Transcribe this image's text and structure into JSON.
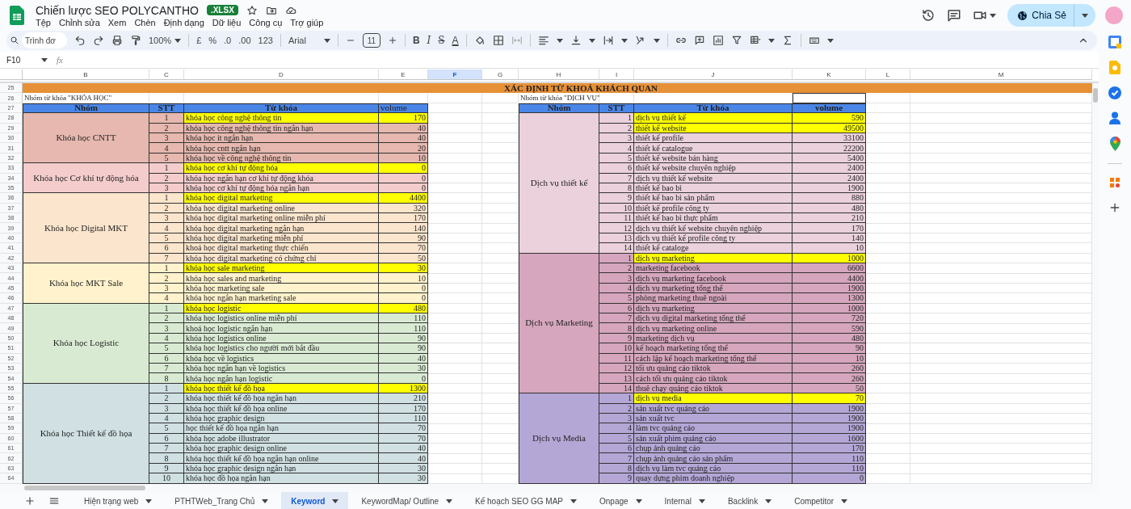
{
  "app": {
    "title": "Chiến lược SEO POLYCANTHO",
    "badge": ".XLSX",
    "menus": [
      "Tệp",
      "Chỉnh sửa",
      "Xem",
      "Chèn",
      "Định dạng",
      "Dữ liệu",
      "Công cụ",
      "Trợ giúp"
    ],
    "share_button": "Chia Sẻ"
  },
  "toolbar": {
    "search_placeholder": "Trình đơ",
    "zoom": "100%",
    "number_buttons": [
      "£",
      "%",
      ".0",
      ".00",
      "123"
    ],
    "font": "Arial",
    "font_size": "11",
    "text_buttons": [
      {
        "kind": "bold",
        "label": "B"
      },
      {
        "kind": "italic",
        "label": "I"
      },
      {
        "kind": "strike",
        "label": "S"
      },
      {
        "kind": "color",
        "label": "A"
      }
    ]
  },
  "formula_bar": {
    "cell_ref": "F10",
    "fx": "fx"
  },
  "columns": [
    {
      "label": "B",
      "selected": false
    },
    {
      "label": "C",
      "selected": false
    },
    {
      "label": "D",
      "selected": false
    },
    {
      "label": "E",
      "selected": false
    },
    {
      "label": "F",
      "selected": true
    },
    {
      "label": "G",
      "selected": false
    },
    {
      "label": "H",
      "selected": false
    },
    {
      "label": "I",
      "selected": false
    },
    {
      "label": "J",
      "selected": false
    },
    {
      "label": "K",
      "selected": false
    },
    {
      "label": "L",
      "selected": false
    },
    {
      "label": "M",
      "selected": false
    }
  ],
  "rows": [
    "25",
    "26",
    "27",
    "28",
    "29",
    "30",
    "31",
    "32",
    "33",
    "34",
    "35",
    "36",
    "37",
    "38",
    "39",
    "40",
    "41",
    "42",
    "43",
    "44",
    "45",
    "46",
    "47",
    "48",
    "49",
    "50",
    "51",
    "52",
    "53",
    "54",
    "55",
    "56",
    "57",
    "58",
    "59",
    "60",
    "61",
    "62",
    "63",
    "64"
  ],
  "title": "XÁC ĐỊNH TỪ KHOÁ KHÁCH QUAN",
  "tables": [
    {
      "caption": "Nhóm từ khóa \"KHÓA HỌC\"",
      "headers": [
        "Nhóm",
        "STT",
        "Từ khóa",
        "volume"
      ],
      "groups": [
        {
          "name": "Khóa học CNTT",
          "color": "#e6b8af",
          "rows": [
            {
              "stt": "1",
              "keyword": "khóa học công nghệ thông tin",
              "volume": "170",
              "highlighted": true
            },
            {
              "stt": "2",
              "keyword": "khóa học công nghệ thông tin ngắn hạn",
              "volume": "40",
              "highlighted": false
            },
            {
              "stt": "3",
              "keyword": "khóa học it ngắn hạn",
              "volume": "40",
              "highlighted": false
            },
            {
              "stt": "4",
              "keyword": "khóa học cntt ngắn hạn",
              "volume": "20",
              "highlighted": false
            },
            {
              "stt": "5",
              "keyword": "khóa học về công nghệ thông tin",
              "volume": "10",
              "highlighted": false
            }
          ]
        },
        {
          "name": "Khóa học Cơ khí tự động hóa",
          "color": "#f4cccc",
          "rows": [
            {
              "stt": "1",
              "keyword": "khóa học cơ khí tự động hóa",
              "volume": "0",
              "highlighted": true
            },
            {
              "stt": "2",
              "keyword": "khóa học ngắn hạn cơ khí tự động khóa",
              "volume": "0",
              "highlighted": false
            },
            {
              "stt": "3",
              "keyword": "khóa học cơ khí tự động hóa ngắn hạn",
              "volume": "0",
              "highlighted": false
            }
          ]
        },
        {
          "name": "Khóa học Digital MKT",
          "color": "#fce5cd",
          "rows": [
            {
              "stt": "1",
              "keyword": "khóa học digital marketing",
              "volume": "4400",
              "highlighted": true
            },
            {
              "stt": "2",
              "keyword": "khóa học digital marketing online",
              "volume": "320",
              "highlighted": false
            },
            {
              "stt": "3",
              "keyword": "khóa học digital marketing online miễn phí",
              "volume": "170",
              "highlighted": false
            },
            {
              "stt": "4",
              "keyword": "khóa học digital marketing ngắn hạn",
              "volume": "140",
              "highlighted": false
            },
            {
              "stt": "5",
              "keyword": "khóa học digital marketing miễn phí",
              "volume": "90",
              "highlighted": false
            },
            {
              "stt": "6",
              "keyword": "khoá học digital marketing thực chiến",
              "volume": "70",
              "highlighted": false
            },
            {
              "stt": "7",
              "keyword": "khóa học digital marketing có chứng chỉ",
              "volume": "50",
              "highlighted": false
            }
          ]
        },
        {
          "name": "Khóa học MKT Sale",
          "color": "#fff2cc",
          "rows": [
            {
              "stt": "1",
              "keyword": "khóa học sale marketing",
              "volume": "30",
              "highlighted": true
            },
            {
              "stt": "2",
              "keyword": "khóa học sales and marketing",
              "volume": "10",
              "highlighted": false
            },
            {
              "stt": "3",
              "keyword": "khóa học marketing sale",
              "volume": "0",
              "highlighted": false
            },
            {
              "stt": "4",
              "keyword": "khóa học ngắn hạn marketing sale",
              "volume": "0",
              "highlighted": false
            }
          ]
        },
        {
          "name": "Khóa học Logistic",
          "color": "#d9ead3",
          "rows": [
            {
              "stt": "1",
              "keyword": "khóa học logistic",
              "volume": "480",
              "highlighted": true
            },
            {
              "stt": "2",
              "keyword": "khóa học logistics online miễn phí",
              "volume": "110",
              "highlighted": false
            },
            {
              "stt": "3",
              "keyword": "khoá học logistic ngắn hạn",
              "volume": "110",
              "highlighted": false
            },
            {
              "stt": "4",
              "keyword": "khóa học logistics online",
              "volume": "90",
              "highlighted": false
            },
            {
              "stt": "5",
              "keyword": "khóa học logistics cho người mới bắt đầu",
              "volume": "90",
              "highlighted": false
            },
            {
              "stt": "6",
              "keyword": "khóa học về logistics",
              "volume": "40",
              "highlighted": false
            },
            {
              "stt": "7",
              "keyword": "khóa học ngắn hạn về logistics",
              "volume": "30",
              "highlighted": false
            },
            {
              "stt": "8",
              "keyword": "khóa học ngắn hạn logistic",
              "volume": "0",
              "highlighted": false
            }
          ]
        },
        {
          "name": "Khóa học Thiết kế đồ họa",
          "color": "#d0e0e3",
          "rows": [
            {
              "stt": "1",
              "keyword": "khóa học thiết kế đồ họa",
              "volume": "1300",
              "highlighted": true
            },
            {
              "stt": "2",
              "keyword": "khóa học thiết kế đồ họa ngắn hạn",
              "volume": "210",
              "highlighted": false
            },
            {
              "stt": "3",
              "keyword": "khóa học thiết kế đồ họa online",
              "volume": "170",
              "highlighted": false
            },
            {
              "stt": "4",
              "keyword": "khóa học graphic design",
              "volume": "110",
              "highlighted": false
            },
            {
              "stt": "5",
              "keyword": "học thiết kế đồ họa ngắn hạn",
              "volume": "70",
              "highlighted": false
            },
            {
              "stt": "6",
              "keyword": "khóa học adobe illustrator",
              "volume": "70",
              "highlighted": false
            },
            {
              "stt": "7",
              "keyword": "khóa học graphic design online",
              "volume": "40",
              "highlighted": false
            },
            {
              "stt": "8",
              "keyword": "khóa học thiết kế đồ họa ngắn hạn online",
              "volume": "40",
              "highlighted": false
            },
            {
              "stt": "9",
              "keyword": "khóa học graphic design ngắn hạn",
              "volume": "30",
              "highlighted": false
            },
            {
              "stt": "10",
              "keyword": "khóa học đồ họa ngắn hạn",
              "volume": "30",
              "highlighted": false
            }
          ]
        }
      ]
    },
    {
      "caption": "Nhóm từ khóa \"DỊCH VỤ\"",
      "headers": [
        "Nhóm",
        "STT",
        "Từ khóa",
        "volume"
      ],
      "groups": [
        {
          "name": "Dịch vụ thiết kế",
          "color": "#ead1dc",
          "rows": [
            {
              "stt": "1",
              "keyword": "dịch vụ thiết kế",
              "volume": "590",
              "highlighted": true
            },
            {
              "stt": "2",
              "keyword": "thiết kế website",
              "volume": "49500",
              "highlighted": true
            },
            {
              "stt": "3",
              "keyword": "thiết kế profile",
              "volume": "33100",
              "highlighted": false
            },
            {
              "stt": "4",
              "keyword": "thiết kế catalogue",
              "volume": "22200",
              "highlighted": false
            },
            {
              "stt": "5",
              "keyword": "thiết kế website bán hàng",
              "volume": "5400",
              "highlighted": false
            },
            {
              "stt": "6",
              "keyword": "thiết kế website chuyên nghiệp",
              "volume": "2400",
              "highlighted": false
            },
            {
              "stt": "7",
              "keyword": "dịch vụ thiết kế website",
              "volume": "2400",
              "highlighted": false
            },
            {
              "stt": "8",
              "keyword": "thiết kế bao bì",
              "volume": "1900",
              "highlighted": false
            },
            {
              "stt": "9",
              "keyword": "thiết kế bao bì sản phẩm",
              "volume": "880",
              "highlighted": false
            },
            {
              "stt": "10",
              "keyword": "thiết kế profile công ty",
              "volume": "480",
              "highlighted": false
            },
            {
              "stt": "11",
              "keyword": "thiết kế bao bì thực phẩm",
              "volume": "210",
              "highlighted": false
            },
            {
              "stt": "12",
              "keyword": "dịch vụ thiết kế website chuyên nghiệp",
              "volume": "170",
              "highlighted": false
            },
            {
              "stt": "13",
              "keyword": "dịch vụ thiết kế profile công ty",
              "volume": "140",
              "highlighted": false
            },
            {
              "stt": "14",
              "keyword": "thiết kế cataloge",
              "volume": "10",
              "highlighted": false
            }
          ]
        },
        {
          "name": "Dịch vụ Marketing",
          "color": "#d5a6bd",
          "rows": [
            {
              "stt": "1",
              "keyword": "dịch vụ marketing",
              "volume": "1000",
              "highlighted": true
            },
            {
              "stt": "2",
              "keyword": "marketing facebook",
              "volume": "6600",
              "highlighted": false
            },
            {
              "stt": "3",
              "keyword": "dịch vụ marketing facebook",
              "volume": "4400",
              "highlighted": false
            },
            {
              "stt": "4",
              "keyword": "dịch vụ marketing tổng thể",
              "volume": "1900",
              "highlighted": false
            },
            {
              "stt": "5",
              "keyword": "phòng marketing thuê ngoài",
              "volume": "1300",
              "highlighted": false
            },
            {
              "stt": "6",
              "keyword": "dịch vụ marketing",
              "volume": "1000",
              "highlighted": false
            },
            {
              "stt": "7",
              "keyword": "dịch vụ digital marketing tổng thể",
              "volume": "720",
              "highlighted": false
            },
            {
              "stt": "8",
              "keyword": "dịch vụ marketing online",
              "volume": "590",
              "highlighted": false
            },
            {
              "stt": "9",
              "keyword": "marketing dịch vụ",
              "volume": "480",
              "highlighted": false
            },
            {
              "stt": "10",
              "keyword": "kế hoạch marketing tổng thể",
              "volume": "90",
              "highlighted": false
            },
            {
              "stt": "11",
              "keyword": "cách lập kế hoạch marketing tổng thể",
              "volume": "10",
              "highlighted": false
            },
            {
              "stt": "12",
              "keyword": "tối ưu quảng cáo tiktok",
              "volume": "260",
              "highlighted": false
            },
            {
              "stt": "13",
              "keyword": "cách tối ưu quảng cáo tiktok",
              "volume": "260",
              "highlighted": false
            },
            {
              "stt": "14",
              "keyword": "thuê chạy quảng cáo tiktok",
              "volume": "50",
              "highlighted": false
            }
          ]
        },
        {
          "name": "Dịch vụ Media",
          "color": "#b4a7d6",
          "rows": [
            {
              "stt": "1",
              "keyword": "dịch vụ media",
              "volume": "70",
              "highlighted": true
            },
            {
              "stt": "2",
              "keyword": "sản xuất tvc quảng cáo",
              "volume": "1900",
              "highlighted": false
            },
            {
              "stt": "3",
              "keyword": "sản xuất tvc",
              "volume": "1900",
              "highlighted": false
            },
            {
              "stt": "4",
              "keyword": "làm tvc quảng cáo",
              "volume": "1900",
              "highlighted": false
            },
            {
              "stt": "5",
              "keyword": "sản xuất phim quảng cáo",
              "volume": "1600",
              "highlighted": false
            },
            {
              "stt": "6",
              "keyword": "chụp ảnh quảng cáo",
              "volume": "170",
              "highlighted": false
            },
            {
              "stt": "7",
              "keyword": "chụp ảnh quảng cáo sản phẩm",
              "volume": "110",
              "highlighted": false
            },
            {
              "stt": "8",
              "keyword": "dịch vụ làm tvc quảng cáo",
              "volume": "110",
              "highlighted": false
            },
            {
              "stt": "9",
              "keyword": "quay dựng phim doanh nghiệp",
              "volume": "0",
              "highlighted": false
            }
          ]
        }
      ]
    }
  ],
  "tabs": [
    {
      "label": "Hiện trạng web",
      "selected": false
    },
    {
      "label": "PTHTWeb_Trang Chủ",
      "selected": false
    },
    {
      "label": "Keyword",
      "selected": true
    },
    {
      "label": "KeywordMap/ Outline",
      "selected": false
    },
    {
      "label": "Kế hoạch SEO GG MAP",
      "selected": false
    },
    {
      "label": "Onpage",
      "selected": false
    },
    {
      "label": "Internal",
      "selected": false
    },
    {
      "label": "Backlink",
      "selected": false
    },
    {
      "label": "Competitor",
      "selected": false
    }
  ]
}
